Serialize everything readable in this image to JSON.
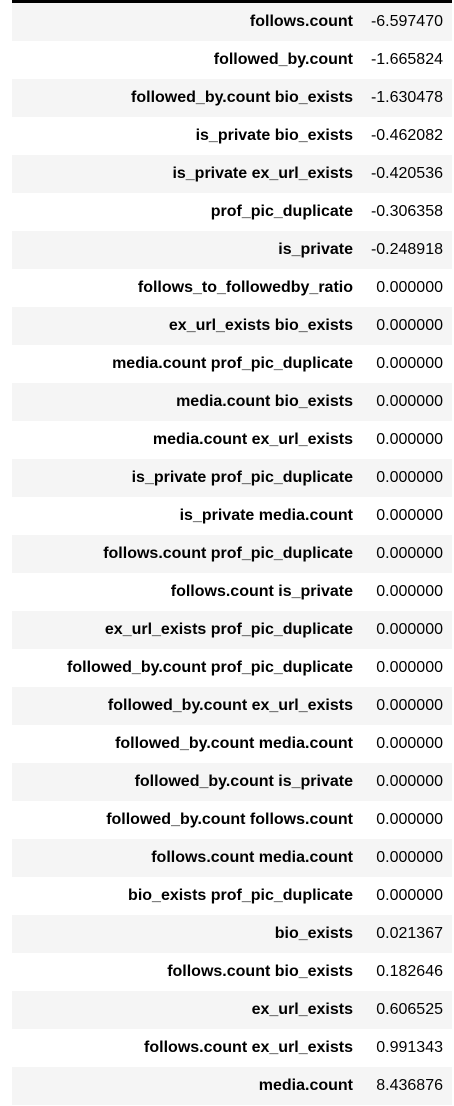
{
  "rows": [
    {
      "label": "follows.count",
      "value": "-6.597470"
    },
    {
      "label": "followed_by.count",
      "value": "-1.665824"
    },
    {
      "label": "followed_by.count bio_exists",
      "value": "-1.630478"
    },
    {
      "label": "is_private bio_exists",
      "value": "-0.462082"
    },
    {
      "label": "is_private ex_url_exists",
      "value": "-0.420536"
    },
    {
      "label": "prof_pic_duplicate",
      "value": "-0.306358"
    },
    {
      "label": "is_private",
      "value": "-0.248918"
    },
    {
      "label": "follows_to_followedby_ratio",
      "value": "0.000000"
    },
    {
      "label": "ex_url_exists bio_exists",
      "value": "0.000000"
    },
    {
      "label": "media.count prof_pic_duplicate",
      "value": "0.000000"
    },
    {
      "label": "media.count bio_exists",
      "value": "0.000000"
    },
    {
      "label": "media.count ex_url_exists",
      "value": "0.000000"
    },
    {
      "label": "is_private prof_pic_duplicate",
      "value": "0.000000"
    },
    {
      "label": "is_private media.count",
      "value": "0.000000"
    },
    {
      "label": "follows.count prof_pic_duplicate",
      "value": "0.000000"
    },
    {
      "label": "follows.count is_private",
      "value": "0.000000"
    },
    {
      "label": "ex_url_exists prof_pic_duplicate",
      "value": "0.000000"
    },
    {
      "label": "followed_by.count prof_pic_duplicate",
      "value": "0.000000"
    },
    {
      "label": "followed_by.count ex_url_exists",
      "value": "0.000000"
    },
    {
      "label": "followed_by.count media.count",
      "value": "0.000000"
    },
    {
      "label": "followed_by.count is_private",
      "value": "0.000000"
    },
    {
      "label": "followed_by.count follows.count",
      "value": "0.000000"
    },
    {
      "label": "follows.count media.count",
      "value": "0.000000"
    },
    {
      "label": "bio_exists prof_pic_duplicate",
      "value": "0.000000"
    },
    {
      "label": "bio_exists",
      "value": "0.021367"
    },
    {
      "label": "follows.count bio_exists",
      "value": "0.182646"
    },
    {
      "label": "ex_url_exists",
      "value": "0.606525"
    },
    {
      "label": "follows.count ex_url_exists",
      "value": "0.991343"
    },
    {
      "label": "media.count",
      "value": "8.436876"
    }
  ]
}
